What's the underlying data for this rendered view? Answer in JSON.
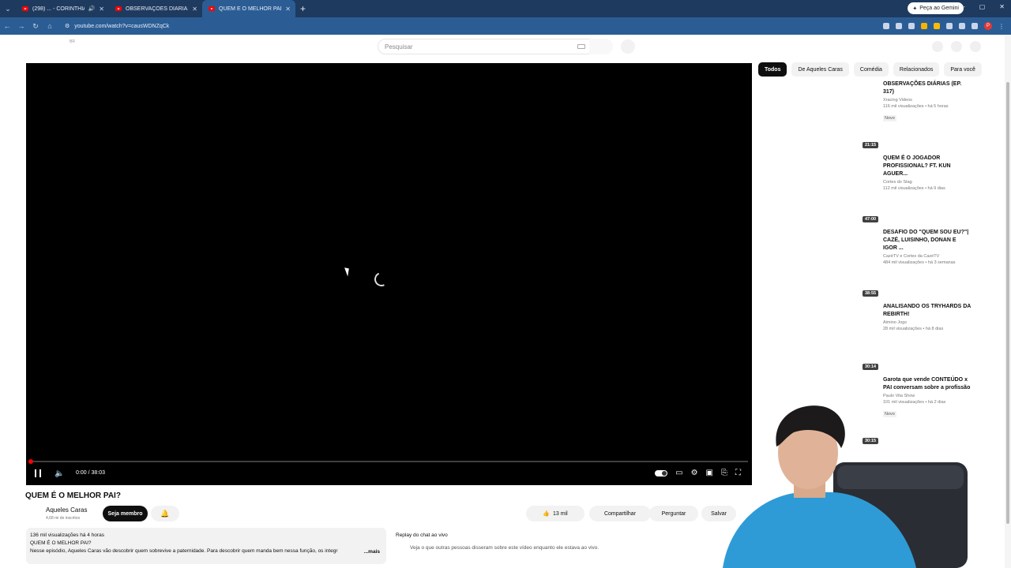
{
  "browser": {
    "tabs": [
      {
        "title": "(298) ... - CORINTHIANS 2/",
        "active": false,
        "speaker": true
      },
      {
        "title": "OBSERVAÇÕES DIÁRIAS (EP. 31",
        "active": false,
        "speaker": false
      },
      {
        "title": "QUEM É O MELHOR PAI? - You",
        "active": true,
        "speaker": false
      }
    ],
    "gemini_label": "Peça ao Gemini",
    "url": "youtube.com/watch?v=causWDNZqCk",
    "profile_initial": "P"
  },
  "masthead": {
    "logo_text": "BR",
    "search_placeholder": "Pesquisar"
  },
  "player": {
    "time": "0:00 / 38:03",
    "progress_fraction": 0.0
  },
  "video": {
    "title": "QUEM É O MELHOR PAI?",
    "channel": "Aqueles Caras",
    "subscribers": "4,68 mi de inscritos",
    "member_label": "Seja membro",
    "likes": "13 mil",
    "share_label": "Compartilhar",
    "ask_label": "Perguntar",
    "save_label": "Salvar",
    "desc_stats": "136 mil visualizações  há 4 horas",
    "desc_line1": "QUEM É O MELHOR PAI?",
    "desc_line2": "Nesse episódio, Aqueles Caras vão descobrir quem sobrevive a paternidade. Para descobrir quem manda bem nessa função, os integr",
    "desc_more": "...mais",
    "chat_title": "Replay do chat ao vivo",
    "chat_sub": "Veja o que outras pessoas disseram sobre este vídeo enquanto ele estava ao vivo."
  },
  "chips": [
    "Todos",
    "De Aqueles Caras",
    "Comédia",
    "Relacionados",
    "Para você"
  ],
  "recommendations": [
    {
      "title": "OBSERVAÇÕES DIÁRIAS (EP. 317)",
      "channel": "Xracing Videos",
      "meta": "116 mil visualizações  • há 5 horas",
      "badge": "Novo",
      "duration": ""
    },
    {
      "title": "QUEM É O JOGADOR PROFISSIONAL? FT. KUN AGUER...",
      "channel": "Cortes do Stag",
      "meta": "112 mil visualizações  • há 9 dias",
      "badge": "",
      "duration": "21:15"
    },
    {
      "title": "DESAFIO DO \"QUEM SOU EU?\"| CAZÉ, LUISINHO, DONAN E IGOR ...",
      "channel": "CazéTV    e Cortes da CazéTV",
      "meta": "484 mil visualizações  • há 3 semanas",
      "badge": "",
      "duration": "47:00"
    },
    {
      "title": "ANALISANDO OS TRYHARDS DA REBIRTH!",
      "channel": "Aimino Jogs",
      "meta": "28 mil visualizações  • há 8 dias",
      "badge": "",
      "duration": "38:55"
    },
    {
      "title": "Garota que vende CONTEÚDO x PAI conversam sobre a profissão",
      "channel": "Paulo Vita Show",
      "meta": "101 mil visualizações  • há 2 dias",
      "badge": "Novo",
      "duration": "30:14"
    },
    {
      "title": "",
      "channel": "",
      "meta": "",
      "badge": "",
      "duration": "30:15"
    }
  ]
}
